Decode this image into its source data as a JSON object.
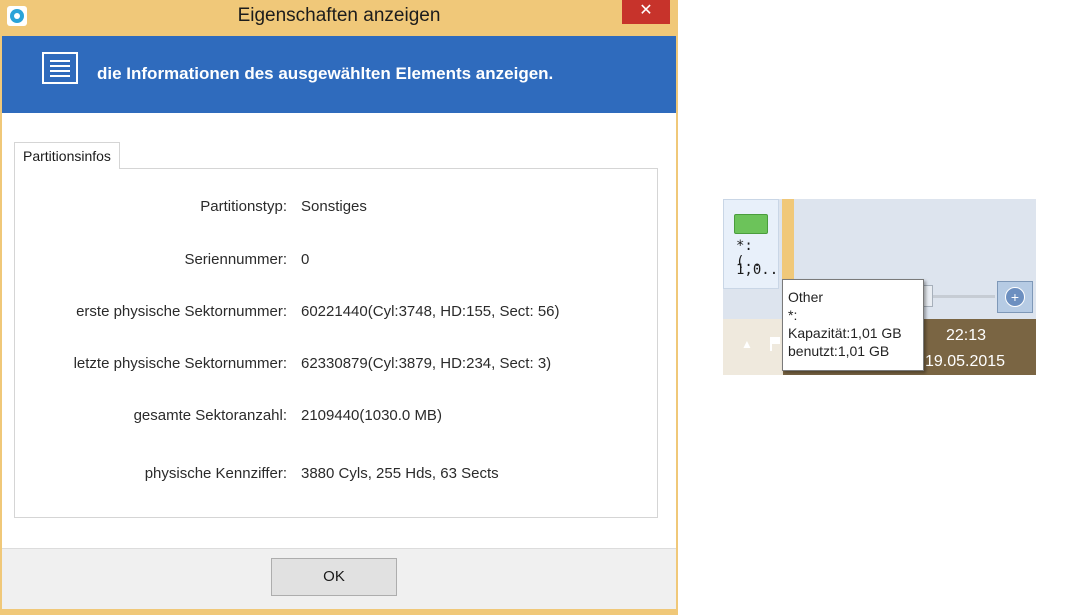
{
  "dialog": {
    "title": "Eigenschaften anzeigen",
    "close_label": "✕",
    "banner_text": "die Informationen des ausgewählten Elements anzeigen.",
    "tab_label": "Partitionsinfos",
    "rows": [
      {
        "label": "Partitionstyp:",
        "value": "Sonstiges"
      },
      {
        "label": "Seriennummer:",
        "value": "0"
      },
      {
        "label": "erste physische Sektornummer:",
        "value": "60221440(Cyl:3748, HD:155, Sect: 56)"
      },
      {
        "label": "letzte physische Sektornummer:",
        "value": "62330879(Cyl:3879, HD:234, Sect: 3)"
      },
      {
        "label": "gesamte Sektoranzahl:",
        "value": "2109440(1030.0 MB)"
      },
      {
        "label": "physische Kennziffer:",
        "value": "3880 Cyls, 255 Hds, 63 Sects"
      }
    ],
    "ok_label": "OK"
  },
  "taskbar": {
    "drive_line1": "*: (..",
    "drive_line2": "1,0..",
    "tooltip": {
      "line1": "Other",
      "line2": "*:",
      "line3": "Kapazität:1,01 GB",
      "line4": "benutzt:1,01 GB"
    },
    "zoom_icon_glyph": "+",
    "tray_arrow": "▲",
    "clock_time": "22:13",
    "clock_date": "19.05.2015"
  },
  "colors": {
    "window_frame": "#f0c879",
    "banner": "#2f6bbd",
    "close_button": "#c7332b",
    "taskbar": "#7a6543",
    "drive_bar": "#6cc35a"
  }
}
